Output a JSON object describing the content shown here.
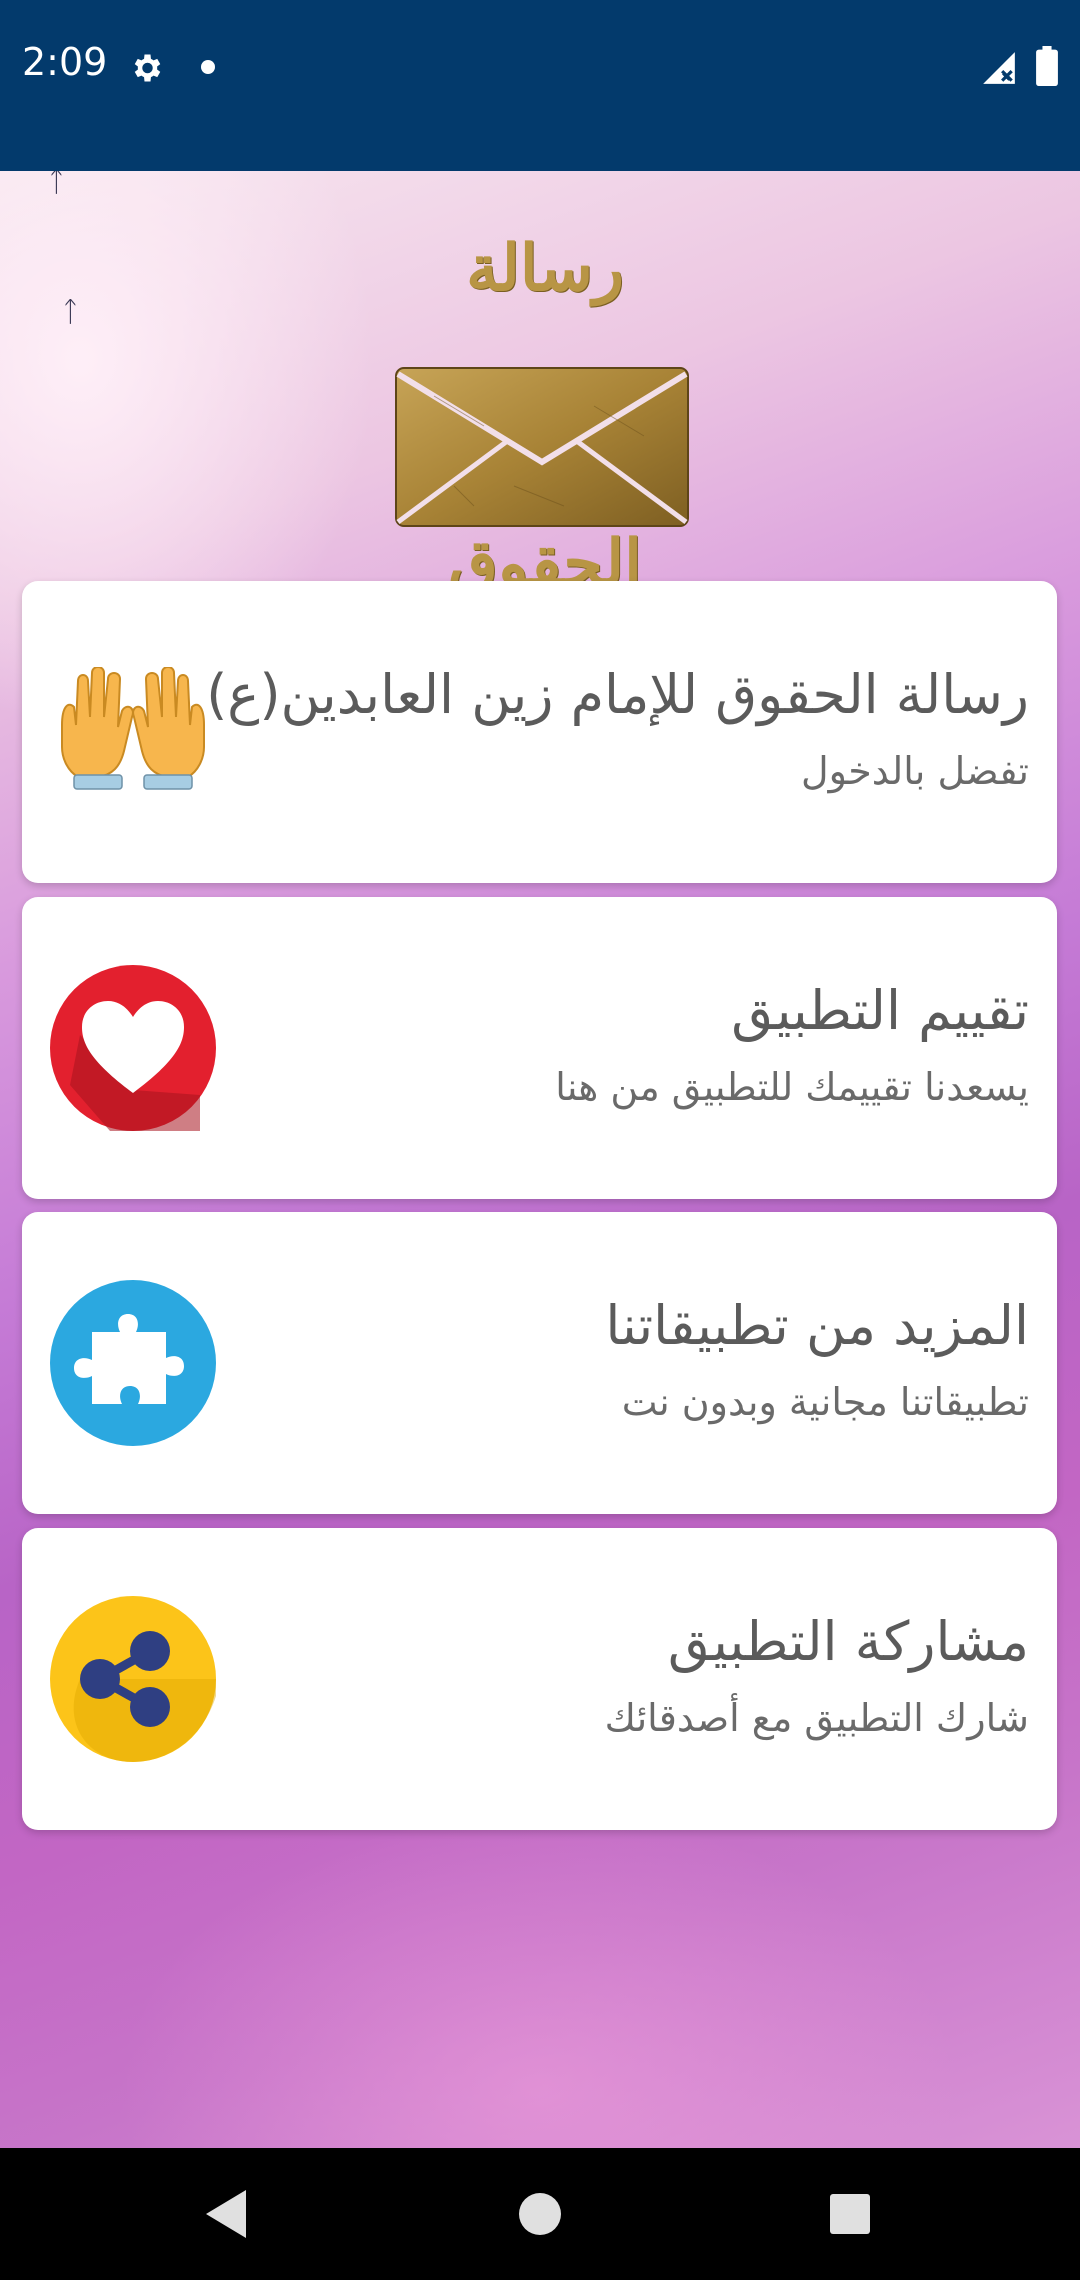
{
  "status_bar": {
    "time": "2:09",
    "icons": [
      "gear-icon",
      "notification-dot-icon",
      "signal-icon",
      "battery-icon"
    ],
    "background_color": "#033a6c"
  },
  "logo": {
    "top_text": "رسالة",
    "bottom_text": "الحقوق",
    "icon": "envelope-icon",
    "color": "#b89545"
  },
  "menu": {
    "items": [
      {
        "title": "رسالة الحقوق للإمام زين العابدين(ع)",
        "subtitle": "تفضل بالدخول",
        "icon": "praying-hands-icon"
      },
      {
        "title": "تقييم التطبيق",
        "subtitle": "يسعدنا تقييمك للتطبيق من هنا",
        "icon": "heart-icon",
        "icon_color": "#e3202e"
      },
      {
        "title": "المزيد من تطبيقاتنا",
        "subtitle": "تطبيقاتنا مجانية وبدون نت",
        "icon": "puzzle-icon",
        "icon_color": "#2ba8e0"
      },
      {
        "title": "مشاركة التطبيق",
        "subtitle": "شارك التطبيق مع أصدقائك",
        "icon": "share-icon",
        "icon_color": "#fcc419"
      }
    ]
  },
  "nav_bar": {
    "buttons": [
      "back-icon",
      "home-icon",
      "recents-icon"
    ]
  }
}
